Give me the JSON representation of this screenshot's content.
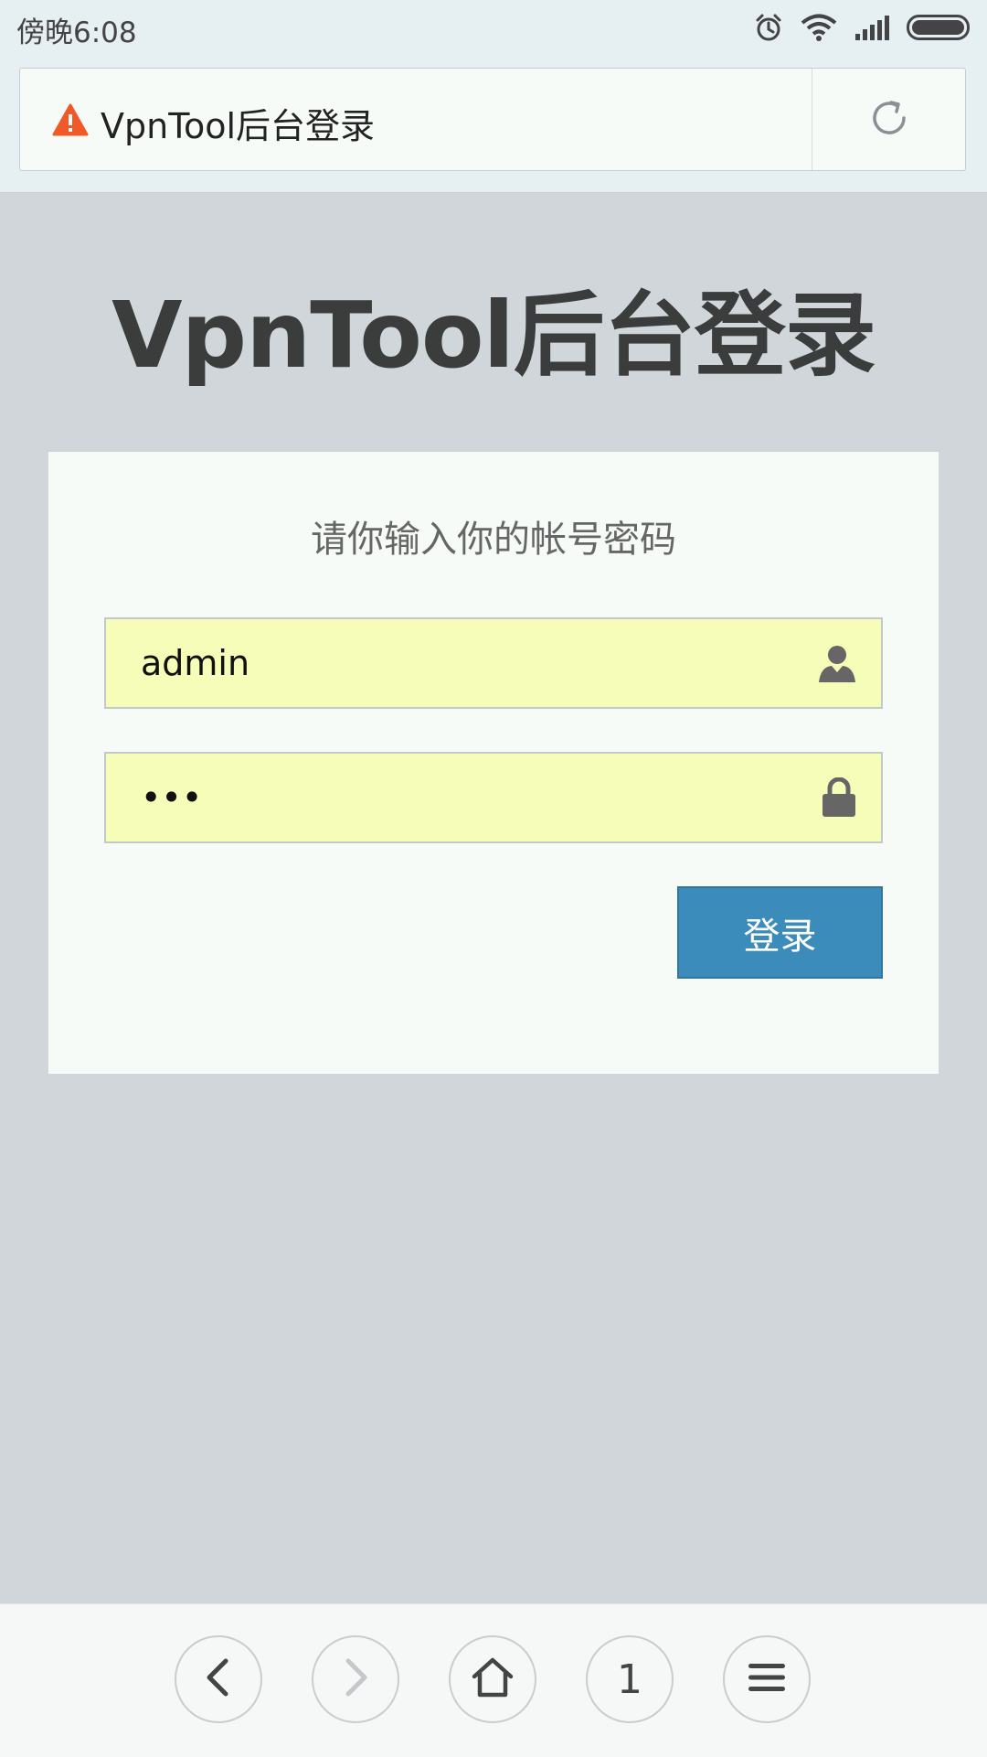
{
  "status_bar": {
    "time": "傍晚6:08",
    "icons": [
      "alarm-icon",
      "wifi-icon",
      "signal-icon",
      "battery-icon"
    ]
  },
  "address_bar": {
    "title": "VpnTool后台登录",
    "warning_icon": "warning-icon",
    "reload_icon": "reload-icon"
  },
  "page": {
    "heading": "VpnTool后台登录",
    "prompt": "请你输入你的帐号密码",
    "username_value": "admin",
    "password_value": "•••",
    "login_label": "登录"
  },
  "bottom_nav": {
    "tab_count": "1",
    "buttons": [
      "back-icon",
      "forward-icon",
      "home-icon",
      "tabs-count",
      "menu-icon"
    ]
  },
  "colors": {
    "page_bg": "#d0d6da",
    "input_bg": "#f5fdb8",
    "button_bg": "#3b8bbb",
    "warning": "#f05a28"
  }
}
